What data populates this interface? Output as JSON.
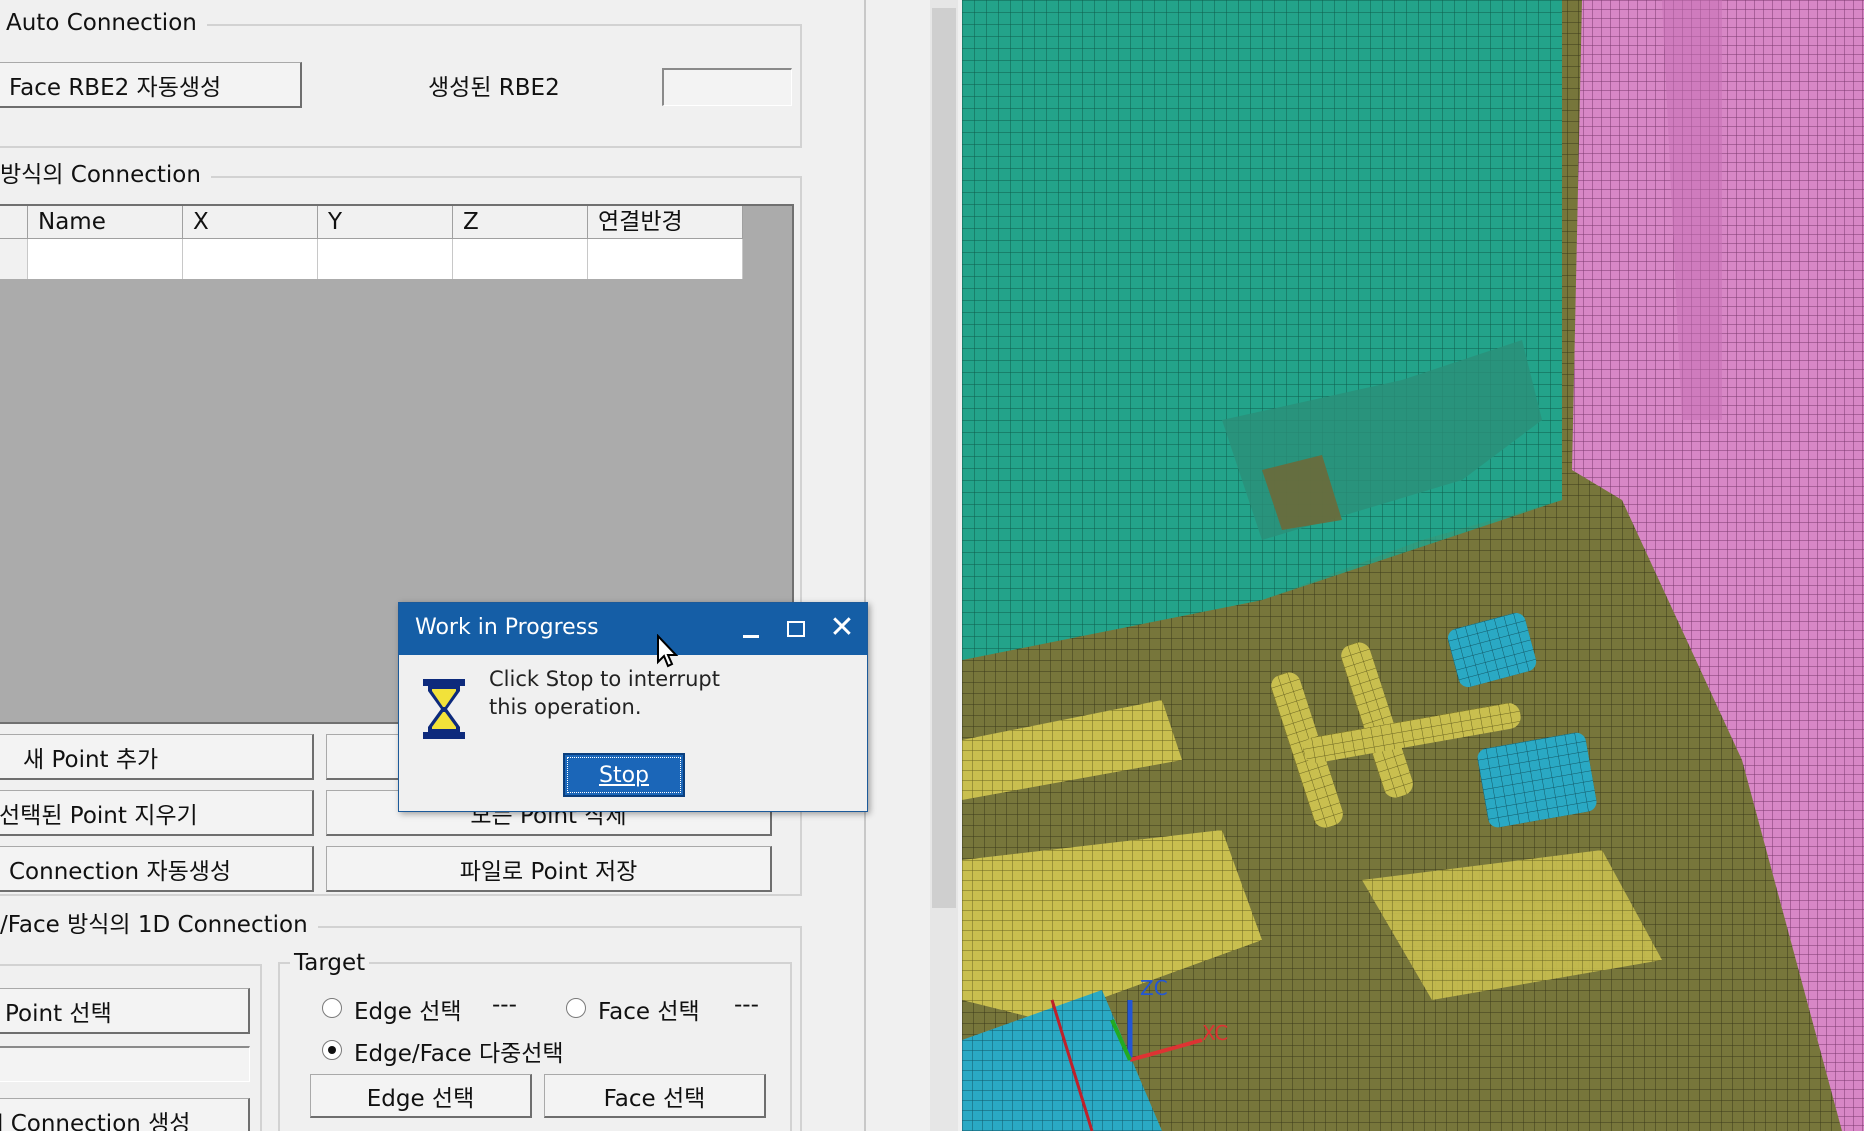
{
  "auto_connection": {
    "group_title": "Auto Connection",
    "face_rbe2_button": "Face RBE2 자동생성",
    "created_rbe2_label": "생성된 RBE2",
    "created_rbe2_value": ""
  },
  "point_connection": {
    "group_title": "방식의 Connection",
    "columns": [
      "Name",
      "X",
      "Y",
      "Z",
      "연결반경"
    ],
    "buttons": {
      "add_point": "새 Point 추가",
      "delete_selected": "선택된 Point 지우기",
      "delete_all": "모든 Point 삭제",
      "auto_create": "Connection 자동생성",
      "save_to_file": "파일로 Point 저장"
    }
  },
  "edge_face_connection": {
    "group_title": "/Face 방식의 1D Connection",
    "point_select_button": "Point 선택",
    "create_button": "l Connection 생성",
    "target": {
      "title": "Target",
      "edge_radio": "Edge 선택",
      "edge_status": "---",
      "face_radio": "Face 선택",
      "face_status": "---",
      "multi_radio": "Edge/Face 다중선택",
      "selected": "multi",
      "edge_button": "Edge 선택",
      "face_button": "Face 선택"
    }
  },
  "dialog": {
    "title": "Work in Progress",
    "message_line1": "Click Stop to interrupt",
    "message_line2": "this operation.",
    "stop_button": "Stop",
    "icon": "hourglass-icon"
  },
  "viewport": {
    "axis_z": "ZC",
    "axis_x": "XC"
  },
  "colors": {
    "teal_mesh": "#23a38a",
    "olive_mesh": "#7a7a3c",
    "pink_mesh": "#d986c8",
    "dialog_titlebar": "#155ea6",
    "stop_button": "#1b66b8"
  }
}
